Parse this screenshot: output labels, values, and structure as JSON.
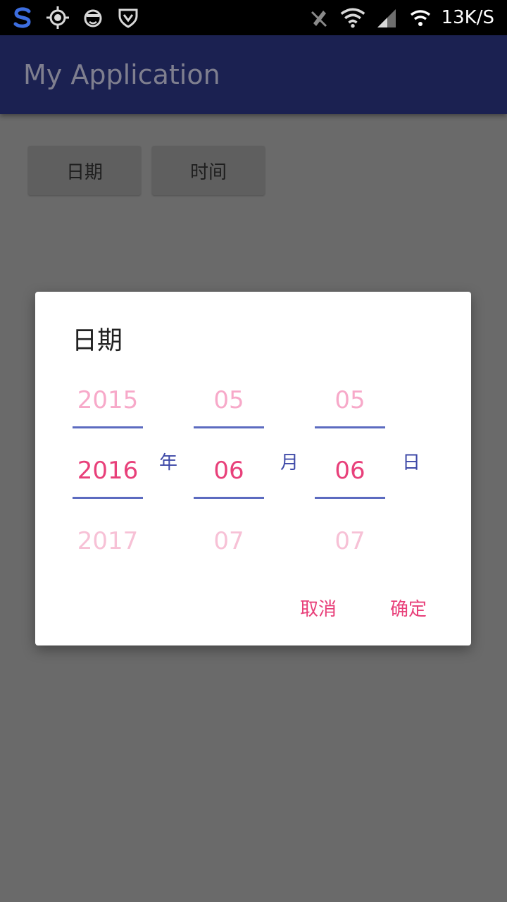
{
  "status_bar": {
    "net_speed": "13K/S",
    "icons": [
      "sogou-icon",
      "gps-icon",
      "face-icon",
      "shield-icon",
      "mute-icon",
      "wifi-icon",
      "signal-icon",
      "wifi-hotspot-icon"
    ]
  },
  "app_bar": {
    "title": "My Application"
  },
  "buttons": {
    "date_label": "日期",
    "time_label": "时间"
  },
  "dialog": {
    "title": "日期",
    "year": {
      "prev": "2015",
      "current": "2016",
      "next": "2017",
      "unit": "年"
    },
    "month": {
      "prev": "05",
      "current": "06",
      "next": "07",
      "unit": "月"
    },
    "day": {
      "prev": "05",
      "current": "06",
      "next": "07",
      "unit": "日"
    },
    "cancel_label": "取消",
    "ok_label": "确定"
  },
  "colors": {
    "accent": "#e8407a",
    "primary_dark": "#1b2151",
    "divider": "#5c6bc0",
    "unit_label": "#3f4aa8"
  }
}
